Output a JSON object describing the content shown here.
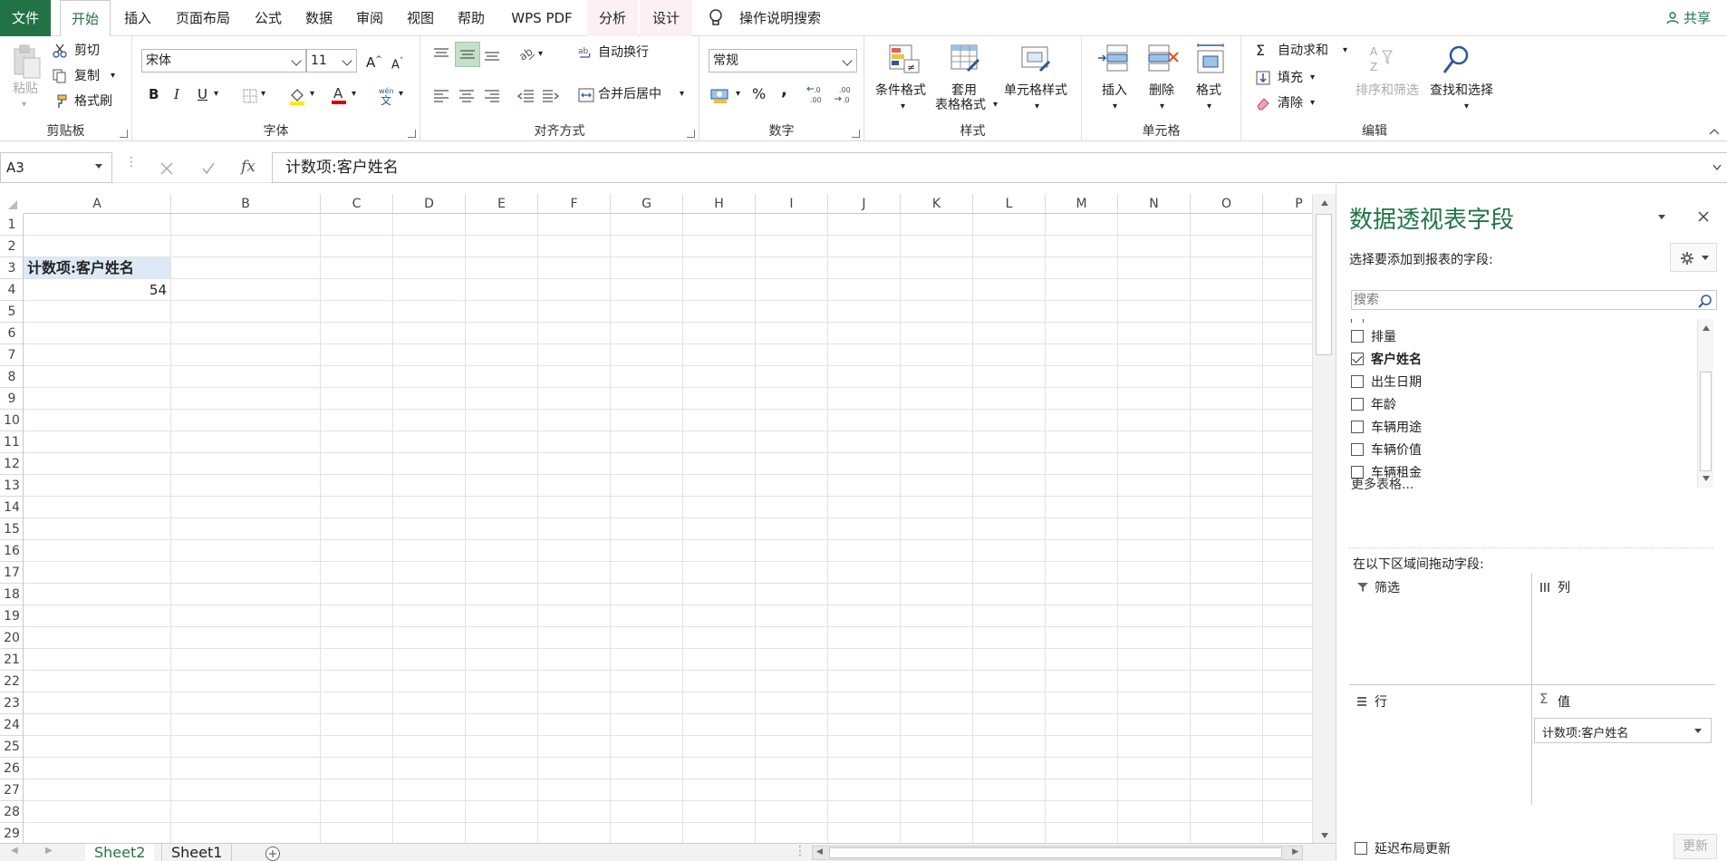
{
  "tabs": {
    "file": "文件",
    "home": "开始",
    "insert": "插入",
    "page_layout": "页面布局",
    "formulas": "公式",
    "data": "数据",
    "review": "审阅",
    "view": "视图",
    "help": "帮助",
    "wps_pdf": "WPS PDF",
    "analyze": "分析",
    "design": "设计",
    "tell_me": "操作说明搜索",
    "share": "共享"
  },
  "ribbon": {
    "clipboard": {
      "label": "剪贴板",
      "paste": "粘贴",
      "cut": "剪切",
      "copy": "复制",
      "format_painter": "格式刷"
    },
    "font": {
      "label": "字体",
      "font_name": "宋体",
      "font_size": "11",
      "bold": "B",
      "italic": "I",
      "underline": "U"
    },
    "alignment": {
      "label": "对齐方式",
      "wrap_text": "自动换行",
      "merge_center": "合并后居中"
    },
    "number": {
      "label": "数字",
      "format": "常规",
      "percent": "%",
      "comma": ","
    },
    "styles": {
      "label": "样式",
      "conditional": "条件格式",
      "table_format_1": "套用",
      "table_format_2": "表格格式",
      "cell_styles": "单元格样式"
    },
    "cells": {
      "label": "单元格",
      "insert": "插入",
      "delete": "删除",
      "format": "格式"
    },
    "editing": {
      "label": "编辑",
      "autosum": "自动求和",
      "fill": "填充",
      "clear": "清除",
      "sort_filter": "排序和筛选",
      "find_select": "查找和选择"
    }
  },
  "formula_bar": {
    "name_box": "A3",
    "fx": "fx",
    "content": "计数项:客户姓名"
  },
  "columns": [
    "A",
    "B",
    "C",
    "D",
    "E",
    "F",
    "G",
    "H",
    "I",
    "J",
    "K",
    "L",
    "M",
    "N",
    "O",
    "P"
  ],
  "rows": [
    "1",
    "2",
    "3",
    "4",
    "5",
    "6",
    "7",
    "8",
    "9",
    "10",
    "11",
    "12",
    "13",
    "14",
    "15",
    "16",
    "17",
    "18",
    "19",
    "20",
    "21",
    "22",
    "23",
    "24",
    "25",
    "26",
    "27",
    "28",
    "29"
  ],
  "cells": {
    "a3": "计数项:客户姓名",
    "a4": "54"
  },
  "sheets": [
    "Sheet2",
    "Sheet1"
  ],
  "pivot_panel": {
    "title": "数据透视表字段",
    "subtitle": "选择要添加到报表的字段:",
    "search_placeholder": "搜索",
    "fields": [
      {
        "name": "排量",
        "checked": false
      },
      {
        "name": "客户姓名",
        "checked": true
      },
      {
        "name": "出生日期",
        "checked": false
      },
      {
        "name": "年龄",
        "checked": false
      },
      {
        "name": "车辆用途",
        "checked": false
      },
      {
        "name": "车辆价值",
        "checked": false
      },
      {
        "name": "车辆租金",
        "checked": false
      }
    ],
    "more_tables": "更多表格...",
    "drag_hint": "在以下区域间拖动字段:",
    "filters": "筛选",
    "columns": "列",
    "rows": "行",
    "values": "值",
    "value_item": "计数项:客户姓名",
    "defer": "延迟布局更新",
    "update": "更新"
  },
  "colors": {
    "accent": "#217346",
    "selected_cell": "#dce9f6",
    "context_tab": "#fdf0f5"
  }
}
